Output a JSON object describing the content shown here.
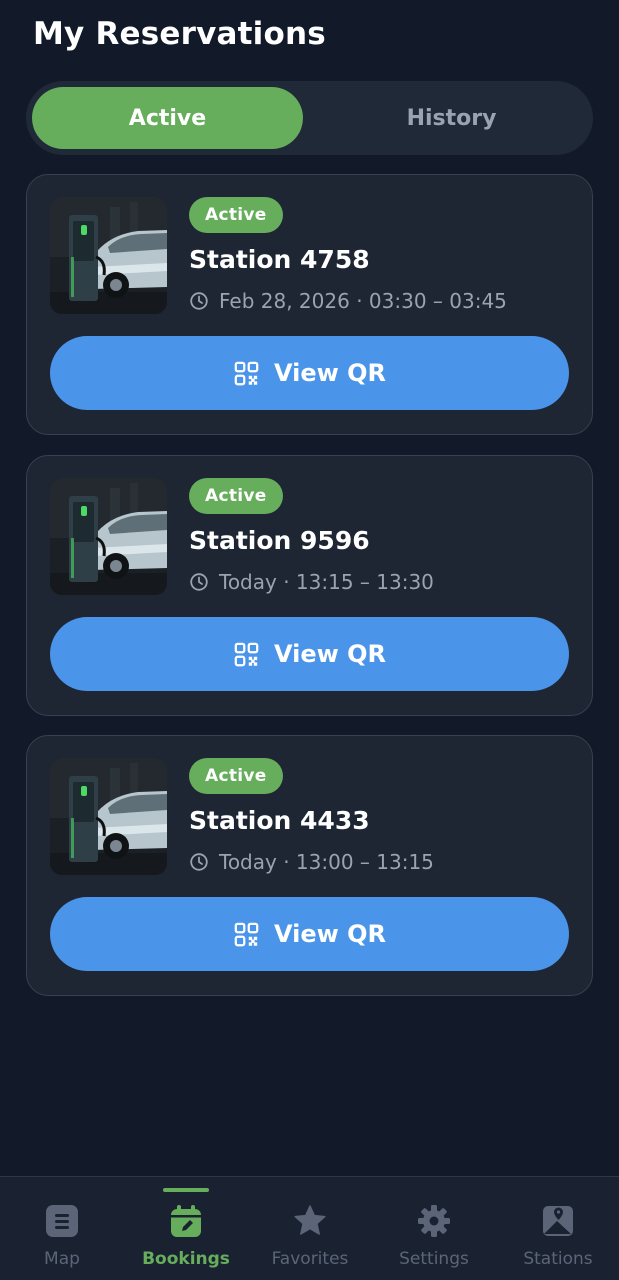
{
  "header": {
    "title": "My Reservations"
  },
  "tabs": [
    {
      "label": "Active",
      "selected": true
    },
    {
      "label": "History",
      "selected": false
    }
  ],
  "reservations": [
    {
      "status": "Active",
      "station": "Station 4758",
      "time": "Feb 28, 2026 · 03:30 – 03:45",
      "action": "View QR"
    },
    {
      "status": "Active",
      "station": "Station 9596",
      "time": "Today · 13:15 – 13:30",
      "action": "View QR"
    },
    {
      "status": "Active",
      "station": "Station 4433",
      "time": "Today · 13:00 – 13:15",
      "action": "View QR"
    }
  ],
  "nav": [
    {
      "label": "Map",
      "icon": "map-icon",
      "active": false
    },
    {
      "label": "Bookings",
      "icon": "calendar-icon",
      "active": true
    },
    {
      "label": "Favorites",
      "icon": "star-icon",
      "active": false
    },
    {
      "label": "Settings",
      "icon": "gear-icon",
      "active": false
    },
    {
      "label": "Stations",
      "icon": "image-pin-icon",
      "active": false
    }
  ],
  "colors": {
    "background": "#121a29",
    "card": "#1e2533",
    "accent_green": "#66ad5c",
    "accent_blue": "#4a94e9",
    "muted_text": "#9aa3b2"
  }
}
